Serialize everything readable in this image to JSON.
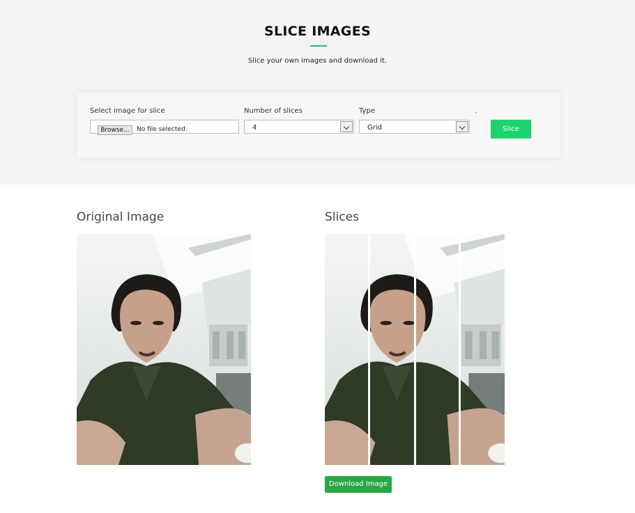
{
  "header": {
    "title": "SLICE IMAGES",
    "subtitle": "Slice your own images and download it."
  },
  "form": {
    "file_label": "Select image for slice",
    "file_button": "Browse...",
    "file_status": "No file selected.",
    "slices_label": "Number of slices",
    "slices_value": "4",
    "type_label": "Type",
    "type_value": "Grid",
    "dot": ".",
    "slice_button": "Slice"
  },
  "results": {
    "original_title": "Original Image",
    "slices_title": "Slices",
    "download_button": "Download Image"
  },
  "colors": {
    "accent": "#1ed36d",
    "download": "#28a745"
  }
}
